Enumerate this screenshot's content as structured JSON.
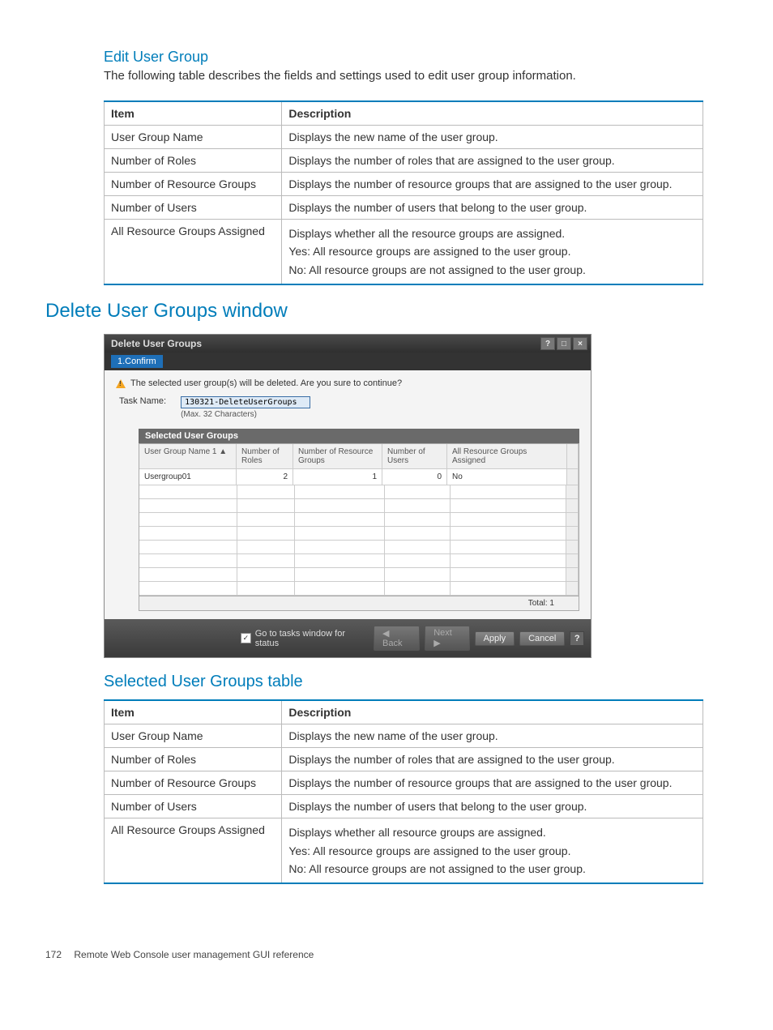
{
  "section1": {
    "heading": "Edit User Group",
    "intro": "The following table describes the fields and settings used to edit user group information.",
    "th_item": "Item",
    "th_desc": "Description",
    "rows": {
      "r0": {
        "item": "User Group Name",
        "desc": "Displays the new name of the user group."
      },
      "r1": {
        "item": "Number of Roles",
        "desc": "Displays the number of roles that are assigned to the user group."
      },
      "r2": {
        "item": "Number of Resource Groups",
        "desc": "Displays the number of resource groups that are assigned to the user group."
      },
      "r3": {
        "item": "Number of Users",
        "desc": "Displays the number of users that belong to the user group."
      },
      "r4": {
        "item": "All Resource Groups Assigned",
        "l1": "Displays whether all the resource groups are assigned.",
        "l2": "Yes: All resource groups are assigned to the user group.",
        "l3": "No: All resource groups are not assigned to the user group."
      }
    }
  },
  "section2_heading": "Delete User Groups window",
  "window": {
    "title": "Delete User Groups",
    "step": "1.Confirm",
    "warning": "The selected user group(s) will be deleted. Are you sure to continue?",
    "task_label": "Task Name:",
    "task_value": "130321-DeleteUserGroups",
    "task_hint": "(Max. 32 Characters)",
    "panel_title": "Selected User Groups",
    "headers": {
      "c1": "User Group Name  1 ▲",
      "c2": "Number of Roles",
      "c3": "Number of Resource Groups",
      "c4": "Number of Users",
      "c5": "All Resource Groups Assigned"
    },
    "row": {
      "c1": "Usergroup01",
      "c2": "2",
      "c3": "1",
      "c4": "0",
      "c5": "No"
    },
    "total_label": "Total:  1",
    "check_label": "Go to tasks window for status",
    "btn_back": "◀ Back",
    "btn_next": "Next ▶",
    "btn_apply": "Apply",
    "btn_cancel": "Cancel"
  },
  "section3": {
    "heading": "Selected User Groups table",
    "th_item": "Item",
    "th_desc": "Description",
    "rows": {
      "r0": {
        "item": "User Group Name",
        "desc": "Displays the new name of the user group."
      },
      "r1": {
        "item": "Number of Roles",
        "desc": "Displays the number of roles that are assigned to the user group."
      },
      "r2": {
        "item": "Number of Resource Groups",
        "desc": "Displays the number of resource groups that are assigned to the user group."
      },
      "r3": {
        "item": "Number of Users",
        "desc": "Displays the number of users that belong to the user group."
      },
      "r4": {
        "item": "All Resource Groups Assigned",
        "l1": "Displays whether all resource groups are assigned.",
        "l2": "Yes: All resource groups are assigned to the user group.",
        "l3": "No: All resource groups are not assigned to the user group."
      }
    }
  },
  "footer": {
    "page": "172",
    "text": "Remote Web Console user management GUI reference"
  }
}
